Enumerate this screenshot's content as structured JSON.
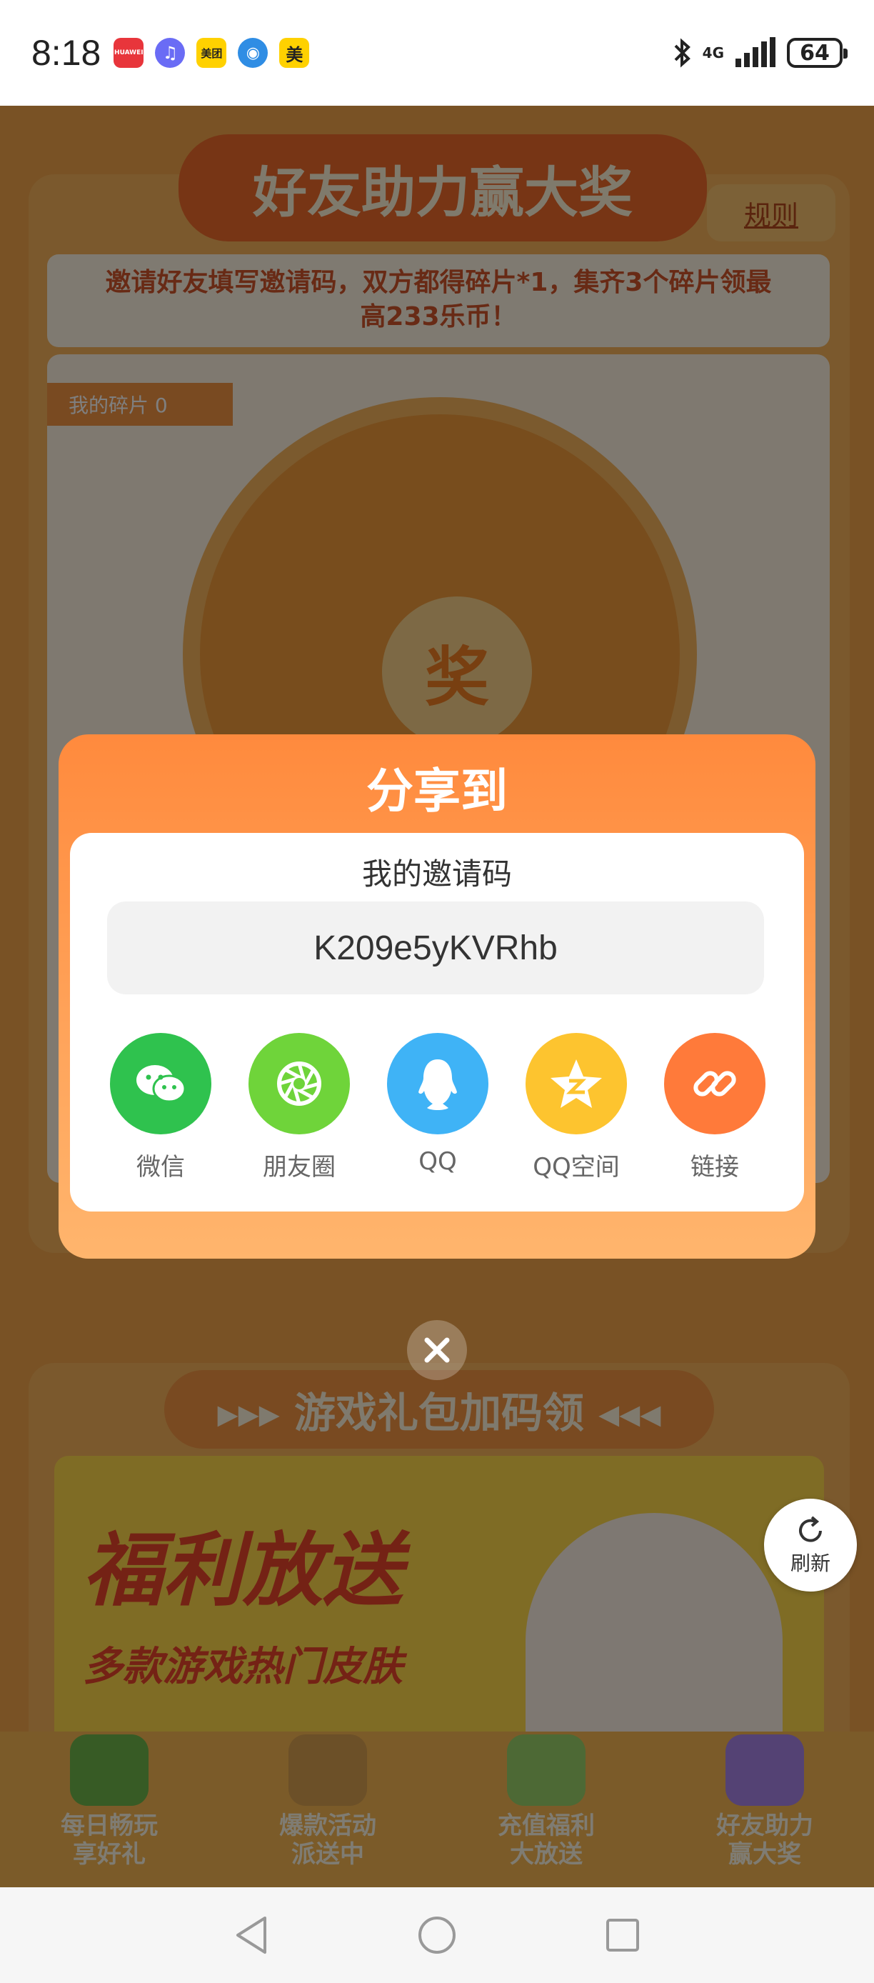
{
  "status_bar": {
    "time": "8:18",
    "apps": [
      {
        "name": "huawei-app",
        "color": "#e8353b",
        "label": "HUAWEI"
      },
      {
        "name": "music-app",
        "color": "#6a6cf5",
        "label": "♫"
      },
      {
        "name": "meituan-app",
        "color": "#ffd100",
        "label": "美团"
      },
      {
        "name": "browser-app",
        "color": "#2f8de4",
        "label": "◉"
      },
      {
        "name": "meituan-app-2",
        "color": "#ffd100",
        "label": "美"
      }
    ],
    "network": "4G",
    "battery": "64"
  },
  "background": {
    "banner_title": "好友助力赢大奖",
    "rules_link": "规则",
    "invite_tip": "邀请好友填写邀请码，双方都得碎片*1，集齐3个碎片领最高233乐币！",
    "shards_label": "我的碎片 0",
    "wheel_hub": "奖",
    "section2_title": "▸▸▸ 游戏礼包加码领 ◂◂◂",
    "promo_title": "福利放送",
    "promo_sub": "多款游戏热门皮肤",
    "bottom_nav": [
      {
        "label_line1": "每日畅玩",
        "label_line2": "享好礼",
        "color": "#6fb64a"
      },
      {
        "label_line1": "爆款活动",
        "label_line2": "派送中",
        "color": "#d8a150"
      },
      {
        "label_line1": "充值福利",
        "label_line2": "大放送",
        "color": "#9bd36a"
      },
      {
        "label_line1": "好友助力",
        "label_line2": "赢大奖",
        "color": "#a985e8"
      }
    ]
  },
  "refresh": {
    "label": "刷新"
  },
  "share_modal": {
    "title": "分享到",
    "code_label": "我的邀请码",
    "invite_code": "K209e5yKVRhb",
    "targets": [
      {
        "label": "微信",
        "color": "#2fc24e",
        "icon": "wechat-icon"
      },
      {
        "label": "朋友圈",
        "color": "#6fd43a",
        "icon": "moments-icon"
      },
      {
        "label": "QQ",
        "color": "#3fb3f6",
        "icon": "qq-icon"
      },
      {
        "label": "QQ空间",
        "color": "#fdc42f",
        "icon": "qzone-icon"
      },
      {
        "label": "链接",
        "color": "#ff7a3a",
        "icon": "link-icon"
      }
    ]
  }
}
